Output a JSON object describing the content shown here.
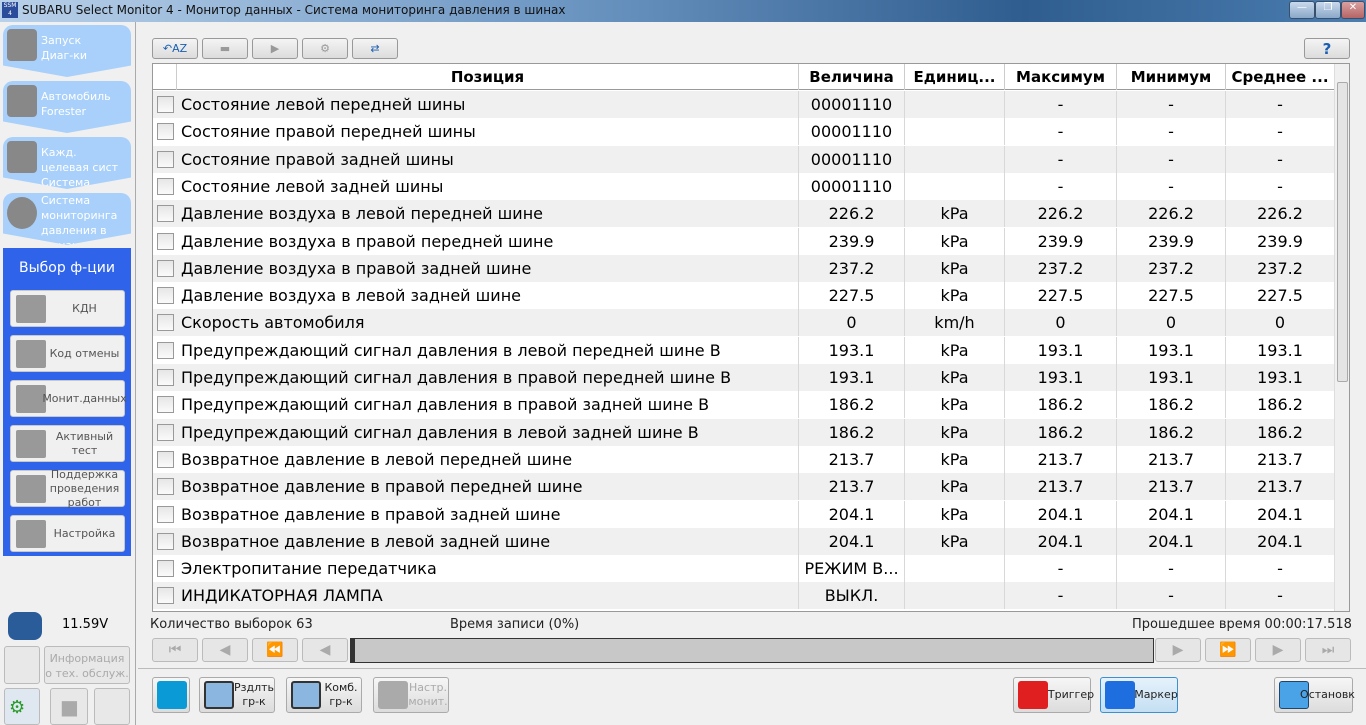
{
  "window": {
    "title": "SUBARU Select Monitor 4 - Монитор данных - Система мониторинга давления в шинах",
    "logo": "SSM 4"
  },
  "nav": [
    {
      "label": "Запуск Диаг-ки"
    },
    {
      "label": "Автомобиль Forester"
    },
    {
      "label": "Кажд. целевая сист Система"
    },
    {
      "label": "Система мониторинга давления в шинах"
    }
  ],
  "function_panel": {
    "title": "Выбор ф-ции",
    "buttons": [
      "КДН",
      "Код отмены",
      "Монит.данных",
      "Активный тест",
      "Поддержка проведения работ",
      "Настройка"
    ]
  },
  "battery": {
    "voltage": "11.59V"
  },
  "left_bottom": {
    "maintenance_info": "Информация о тех. обслуж."
  },
  "toolbar": {
    "help": "?"
  },
  "table": {
    "columns": [
      "Позиция",
      "Величина",
      "Единиц...",
      "Максимум",
      "Минимум",
      "Среднее ..."
    ],
    "rows": [
      [
        "Состояние левой передней шины",
        "00001110",
        "",
        "-",
        "-",
        "-"
      ],
      [
        "Состояние правой передней шины",
        "00001110",
        "",
        "-",
        "-",
        "-"
      ],
      [
        "Состояние правой задней шины",
        "00001110",
        "",
        "-",
        "-",
        "-"
      ],
      [
        "Состояние левой задней шины",
        "00001110",
        "",
        "-",
        "-",
        "-"
      ],
      [
        "Давление воздуха в левой передней шине",
        "226.2",
        "kPa",
        "226.2",
        "226.2",
        "226.2"
      ],
      [
        "Давление воздуха в правой передней шине",
        "239.9",
        "kPa",
        "239.9",
        "239.9",
        "239.9"
      ],
      [
        "Давление воздуха в правой задней шине",
        "237.2",
        "kPa",
        "237.2",
        "237.2",
        "237.2"
      ],
      [
        "Давление воздуха в левой задней шине",
        "227.5",
        "kPa",
        "227.5",
        "227.5",
        "227.5"
      ],
      [
        "Скорость автомобиля",
        "0",
        "km/h",
        "0",
        "0",
        "0"
      ],
      [
        "Предупреждающий сигнал давления в левой передней шине B",
        "193.1",
        "kPa",
        "193.1",
        "193.1",
        "193.1"
      ],
      [
        "Предупреждающий сигнал давления в правой передней шине B",
        "193.1",
        "kPa",
        "193.1",
        "193.1",
        "193.1"
      ],
      [
        "Предупреждающий сигнал давления в правой задней шине B",
        "186.2",
        "kPa",
        "186.2",
        "186.2",
        "186.2"
      ],
      [
        "Предупреждающий сигнал давления в левой задней шине B",
        "186.2",
        "kPa",
        "186.2",
        "186.2",
        "186.2"
      ],
      [
        "Возвратное давление в левой передней шине",
        "213.7",
        "kPa",
        "213.7",
        "213.7",
        "213.7"
      ],
      [
        "Возвратное давление в правой передней шине",
        "213.7",
        "kPa",
        "213.7",
        "213.7",
        "213.7"
      ],
      [
        "Возвратное давление в правой задней шине",
        "204.1",
        "kPa",
        "204.1",
        "204.1",
        "204.1"
      ],
      [
        "Возвратное давление в левой задней шине",
        "204.1",
        "kPa",
        "204.1",
        "204.1",
        "204.1"
      ],
      [
        "Электропитание передатчика",
        "РЕЖИМ В...",
        "",
        "-",
        "-",
        "-"
      ],
      [
        "ИНДИКАТОРНАЯ ЛАМПА",
        "ВЫКЛ.",
        "",
        "-",
        "-",
        "-"
      ]
    ]
  },
  "status": {
    "samples": "Количество выборок 63",
    "record_time": "Время записи (0%)",
    "elapsed": "Прошедшее время 00:00:17.518"
  },
  "bottom": {
    "split_graph": "Рздлть гр-к",
    "combined_graph": "Комб. гр-к",
    "monitor_settings": "Настр. монит.",
    "trigger": "Триггер",
    "marker": "Маркер",
    "stop": "Остановк"
  }
}
